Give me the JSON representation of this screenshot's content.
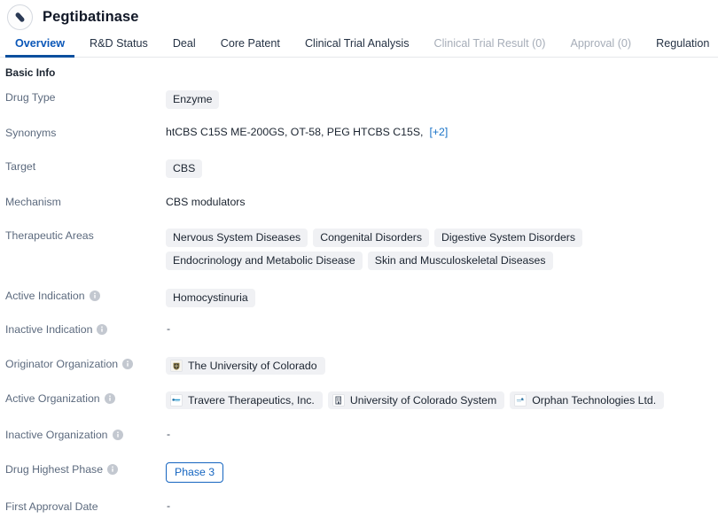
{
  "header": {
    "title": "Pegtibatinase",
    "avatar_icon": "pill-capsule-icon"
  },
  "tabs": [
    {
      "label": "Overview",
      "state": "active"
    },
    {
      "label": "R&D Status",
      "state": "enabled"
    },
    {
      "label": "Deal",
      "state": "enabled"
    },
    {
      "label": "Core Patent",
      "state": "enabled"
    },
    {
      "label": "Clinical Trial Analysis",
      "state": "enabled"
    },
    {
      "label": "Clinical Trial Result (0)",
      "state": "disabled"
    },
    {
      "label": "Approval (0)",
      "state": "disabled"
    },
    {
      "label": "Regulation",
      "state": "enabled"
    }
  ],
  "section": {
    "title": "Basic Info"
  },
  "fields": {
    "drug_type": {
      "label": "Drug Type",
      "tags": [
        "Enzyme"
      ]
    },
    "synonyms": {
      "label": "Synonyms",
      "text": "htCBS C15S ME-200GS,  OT-58,  PEG HTCBS C15S,",
      "more": "[+2]"
    },
    "target": {
      "label": "Target",
      "tags": [
        "CBS"
      ]
    },
    "mechanism": {
      "label": "Mechanism",
      "value": "CBS modulators"
    },
    "therapeutic_areas": {
      "label": "Therapeutic Areas",
      "tags": [
        "Nervous System Diseases",
        "Congenital Disorders",
        "Digestive System Disorders",
        "Endocrinology and Metabolic Disease",
        "Skin and Musculoskeletal Diseases"
      ]
    },
    "active_indication": {
      "label": "Active Indication",
      "has_info": true,
      "tags": [
        "Homocystinuria"
      ]
    },
    "inactive_indication": {
      "label": "Inactive Indication",
      "has_info": true,
      "value": "-"
    },
    "originator_organization": {
      "label": "Originator Organization",
      "has_info": true,
      "orgs": [
        {
          "name": "The University of Colorado",
          "logo": "university-crest-logo"
        }
      ]
    },
    "active_organization": {
      "label": "Active Organization",
      "has_info": true,
      "orgs": [
        {
          "name": "Travere Therapeutics, Inc.",
          "logo": "travere-logo"
        },
        {
          "name": "University of Colorado System",
          "logo": "building-logo"
        },
        {
          "name": "Orphan Technologies Ltd.",
          "logo": "orphan-tech-logo"
        }
      ]
    },
    "inactive_organization": {
      "label": "Inactive Organization",
      "has_info": true,
      "value": "-"
    },
    "drug_highest_phase": {
      "label": "Drug Highest Phase",
      "has_info": true,
      "badge": "Phase 3"
    },
    "first_approval_date": {
      "label": "First Approval Date",
      "value": "-"
    }
  },
  "colors": {
    "accent_blue": "#0b57b8",
    "tab_underline": "#0b4f9e",
    "link_blue": "#1a73c7",
    "phase_blue": "#1565c0",
    "tag_bg": "#f0f1f4",
    "label_gray": "#5c6a7e",
    "border_gray": "#e6e8eb"
  }
}
